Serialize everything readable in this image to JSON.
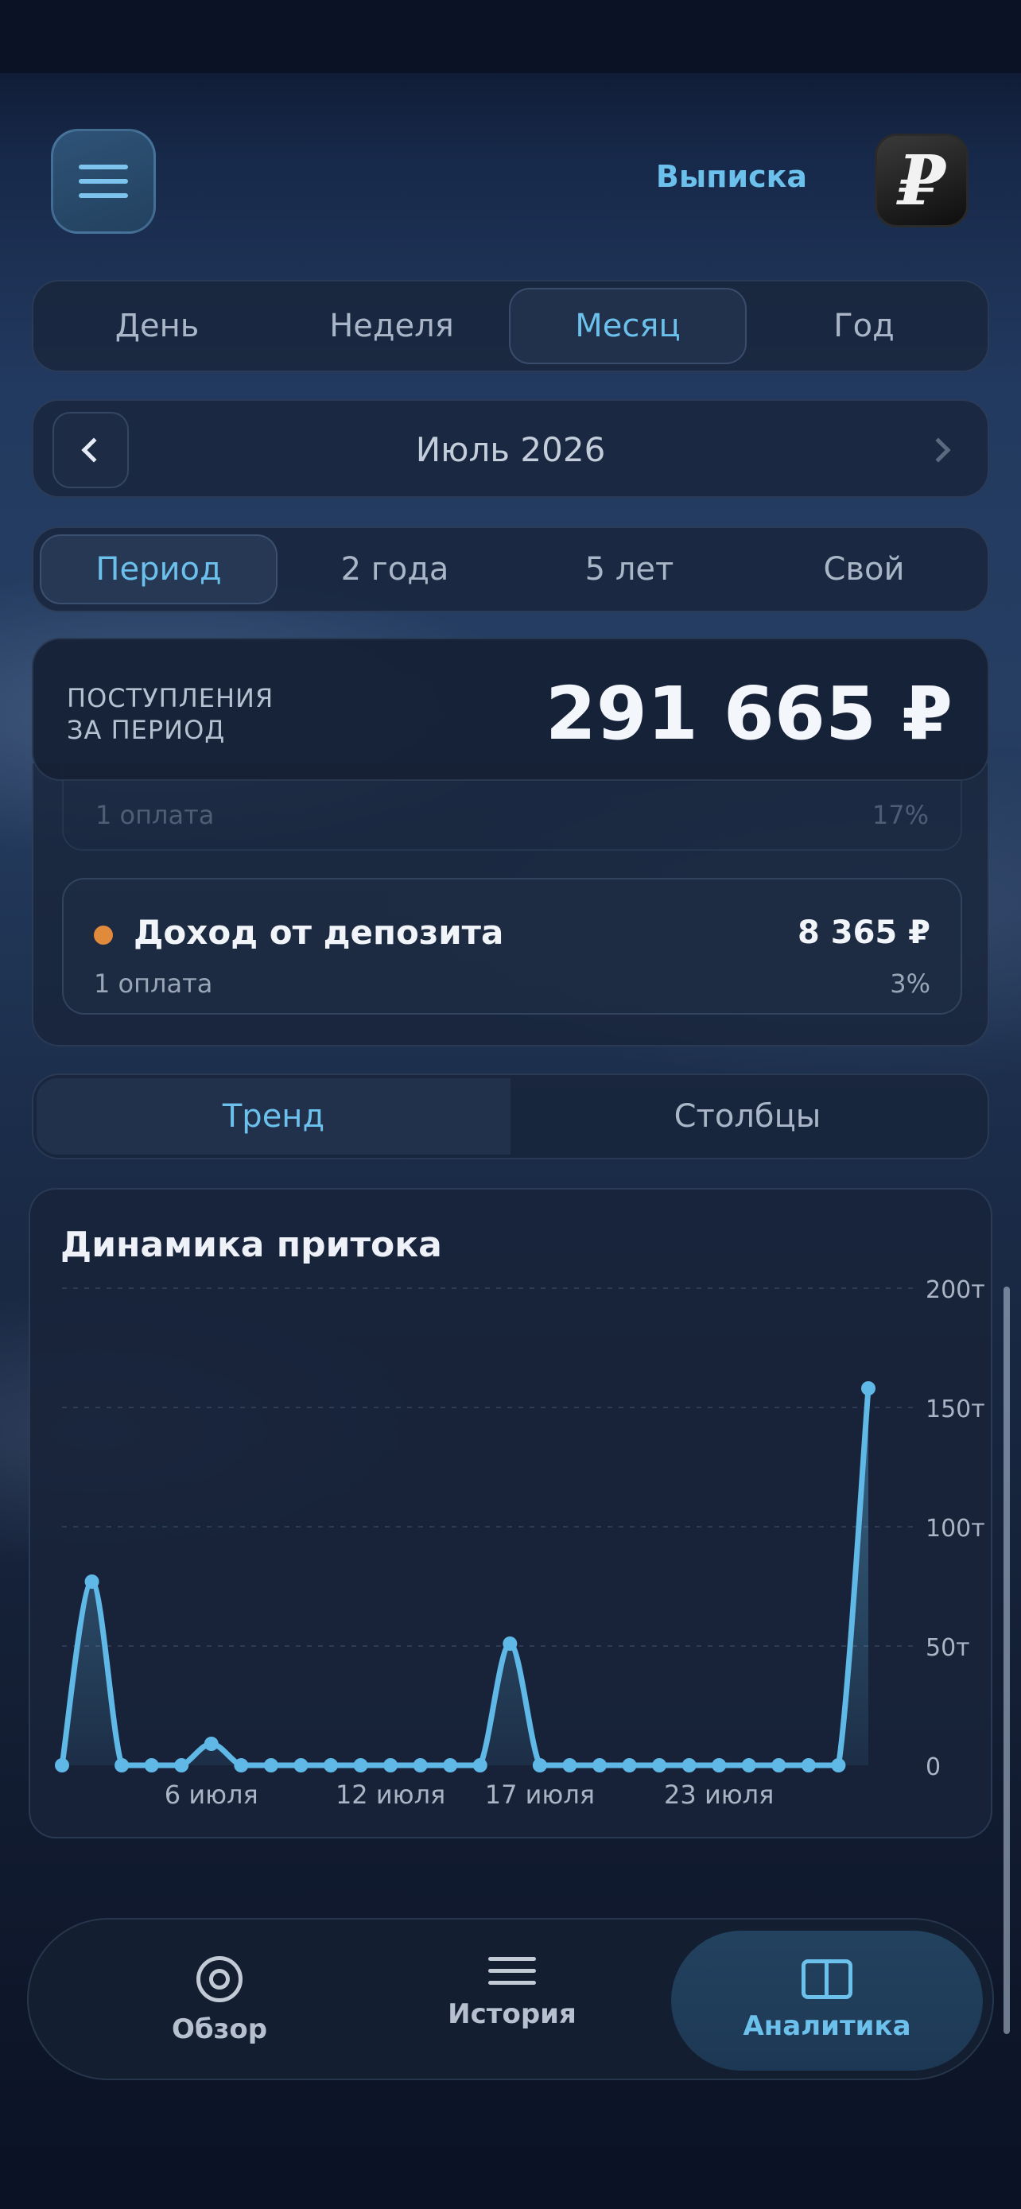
{
  "header": {
    "menu_icon": "hamburger-icon",
    "statement_label": "Выписка",
    "logo_text": "₽"
  },
  "granularity_tabs": [
    {
      "label": "День",
      "active": false
    },
    {
      "label": "Неделя",
      "active": false
    },
    {
      "label": "Месяц",
      "active": true
    },
    {
      "label": "Год",
      "active": false
    }
  ],
  "month_nav": {
    "title": "Июль 2026"
  },
  "range_tabs": [
    {
      "label": "Период",
      "active": true
    },
    {
      "label": "2 года",
      "active": false
    },
    {
      "label": "5 лет",
      "active": false
    },
    {
      "label": "Свой",
      "active": false
    }
  ],
  "total": {
    "label_line1": "ПОСТУПЛЕНИЯ",
    "label_line2": "ЗА ПЕРИОД",
    "amount": "291 665 ₽"
  },
  "income_list": {
    "faded_row": {
      "count": "1 оплата",
      "percent": "17%"
    },
    "items": [
      {
        "name": "Доход от депозита",
        "amount": "8 365 ₽",
        "count": "1 оплата",
        "percent": "3%",
        "color": "#e08a3c"
      }
    ]
  },
  "view_toggle": [
    {
      "label": "Тренд",
      "active": true
    },
    {
      "label": "Столбцы",
      "active": false
    }
  ],
  "chart": {
    "title": "Динамика притока"
  },
  "chart_data": {
    "type": "area",
    "title": "Динамика притока",
    "x": [
      1,
      2,
      3,
      4,
      5,
      6,
      7,
      8,
      9,
      10,
      11,
      12,
      13,
      14,
      15,
      16,
      17,
      18,
      19,
      20,
      21,
      22,
      23,
      24,
      25,
      26,
      27,
      28
    ],
    "series": [
      {
        "values": [
          0,
          77,
          0,
          0,
          0,
          9,
          0,
          0,
          0,
          0,
          0,
          0,
          0,
          0,
          0,
          51,
          0,
          0,
          0,
          0,
          0,
          0,
          0,
          0,
          0,
          0,
          0,
          158
        ]
      }
    ],
    "x_tick_labels": [
      {
        "x": 6,
        "label": "6 июля"
      },
      {
        "x": 12,
        "label": "12 июля"
      },
      {
        "x": 17,
        "label": "17 июля"
      },
      {
        "x": 23,
        "label": "23 июля"
      }
    ],
    "y_ticks": [
      0,
      50,
      100,
      150,
      200
    ],
    "y_tick_labels": [
      "0",
      "50т",
      "100т",
      "150т",
      "200т"
    ],
    "ylim": [
      0,
      200
    ],
    "grid": true,
    "color": "#5fb8e6"
  },
  "bottom_nav": [
    {
      "label": "Обзор",
      "icon": "target-icon",
      "active": false
    },
    {
      "label": "История",
      "icon": "list-icon",
      "active": false
    },
    {
      "label": "Аналитика",
      "icon": "columns-icon",
      "active": true
    }
  ],
  "colors": {
    "accent": "#6cc0ec",
    "background": "#0c1428",
    "panel": "#18243a",
    "deposit_dot": "#e08a3c"
  }
}
